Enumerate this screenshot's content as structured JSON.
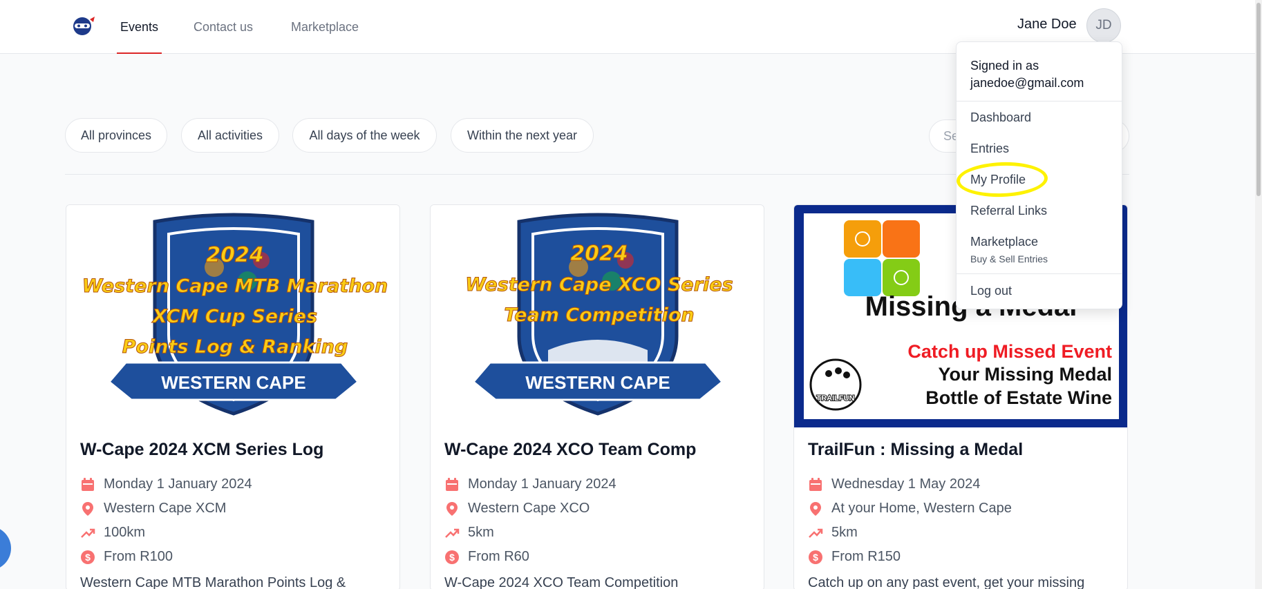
{
  "colors": {
    "accent": "#dc2626",
    "highlight": "#fef200",
    "icon": "#f87171"
  },
  "nav": {
    "logo": "ninja-logo-icon",
    "items": [
      {
        "label": "Events",
        "active": true
      },
      {
        "label": "Contact us",
        "active": false
      },
      {
        "label": "Marketplace",
        "active": false
      }
    ]
  },
  "user": {
    "name": "Jane Doe",
    "initials": "JD"
  },
  "filters": [
    "All provinces",
    "All activities",
    "All days of the week",
    "Within the next year"
  ],
  "search": {
    "placeholder": "Se"
  },
  "dropdown": {
    "signed_in_label": "Signed in as",
    "email": "janedoe@gmail.com",
    "items": [
      "Dashboard",
      "Entries",
      "My Profile",
      "Referral Links",
      "Marketplace"
    ],
    "marketplace_sub": "Buy & Sell Entries",
    "logout": "Log out"
  },
  "cards": [
    {
      "title": "W-Cape 2024 XCM Series Log",
      "date": "Monday 1 January 2024",
      "location": "Western Cape XCM",
      "distance": "100km",
      "price": "From R100",
      "description": "Western Cape MTB Marathon Points Log &",
      "image": {
        "year": "2024",
        "line1": "Western Cape MTB Marathon",
        "line2": "XCM Cup Series",
        "line3": "Points Log & Ranking",
        "banner": "WESTERN CAPE"
      }
    },
    {
      "title": "W-Cape 2024 XCO Team Comp",
      "date": "Monday 1 January 2024",
      "location": "Western Cape XCO",
      "distance": "5km",
      "price": "From R60",
      "description": "W-Cape 2024 XCO Team Competition",
      "image": {
        "year": "2024",
        "line1": "Western Cape XCO Series",
        "line2": "Team Competition",
        "banner": "WESTERN CAPE"
      }
    },
    {
      "title": "TrailFun : Missing a Medal",
      "date": "Wednesday 1 May 2024",
      "location": "At your Home, Western Cape",
      "distance": "5km",
      "price": "From R150",
      "description": "Catch up on any past event, get your missing",
      "image": {
        "headline": "Missing a Medal",
        "red_line": "Catch up Missed Event",
        "line2": "Your Missing Medal",
        "line3": "Bottle of Estate Wine",
        "logo_text": "TRAILFUN"
      }
    }
  ]
}
